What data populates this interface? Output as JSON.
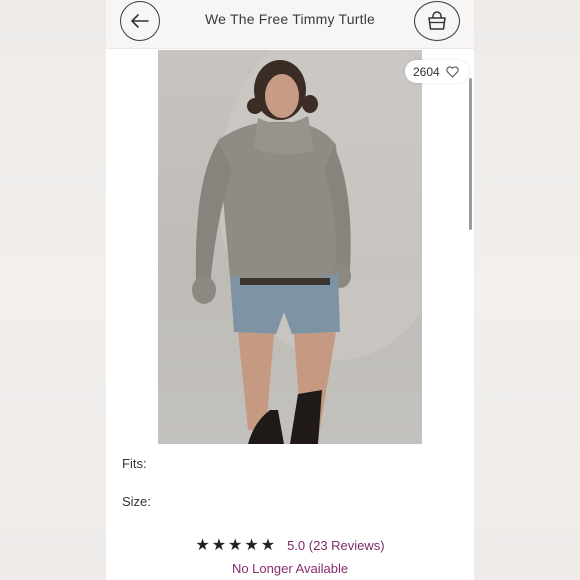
{
  "header": {
    "title": "We The Free Timmy Turtle",
    "back_icon": "arrow-left-icon",
    "bag_icon": "shopping-bag-icon"
  },
  "likes": {
    "count": "2604",
    "icon": "heart-outline-icon"
  },
  "details": {
    "fits_label": "Fits:",
    "size_label": "Size:"
  },
  "rating": {
    "stars": "★★★★★",
    "value": 5.0,
    "text": "5.0 (23 Reviews)"
  },
  "status": "No Longer Available",
  "colors": {
    "accent": "#8a2b6d",
    "header_bg": "#f7f6f5",
    "photo_bg": "#c4c1bc"
  }
}
